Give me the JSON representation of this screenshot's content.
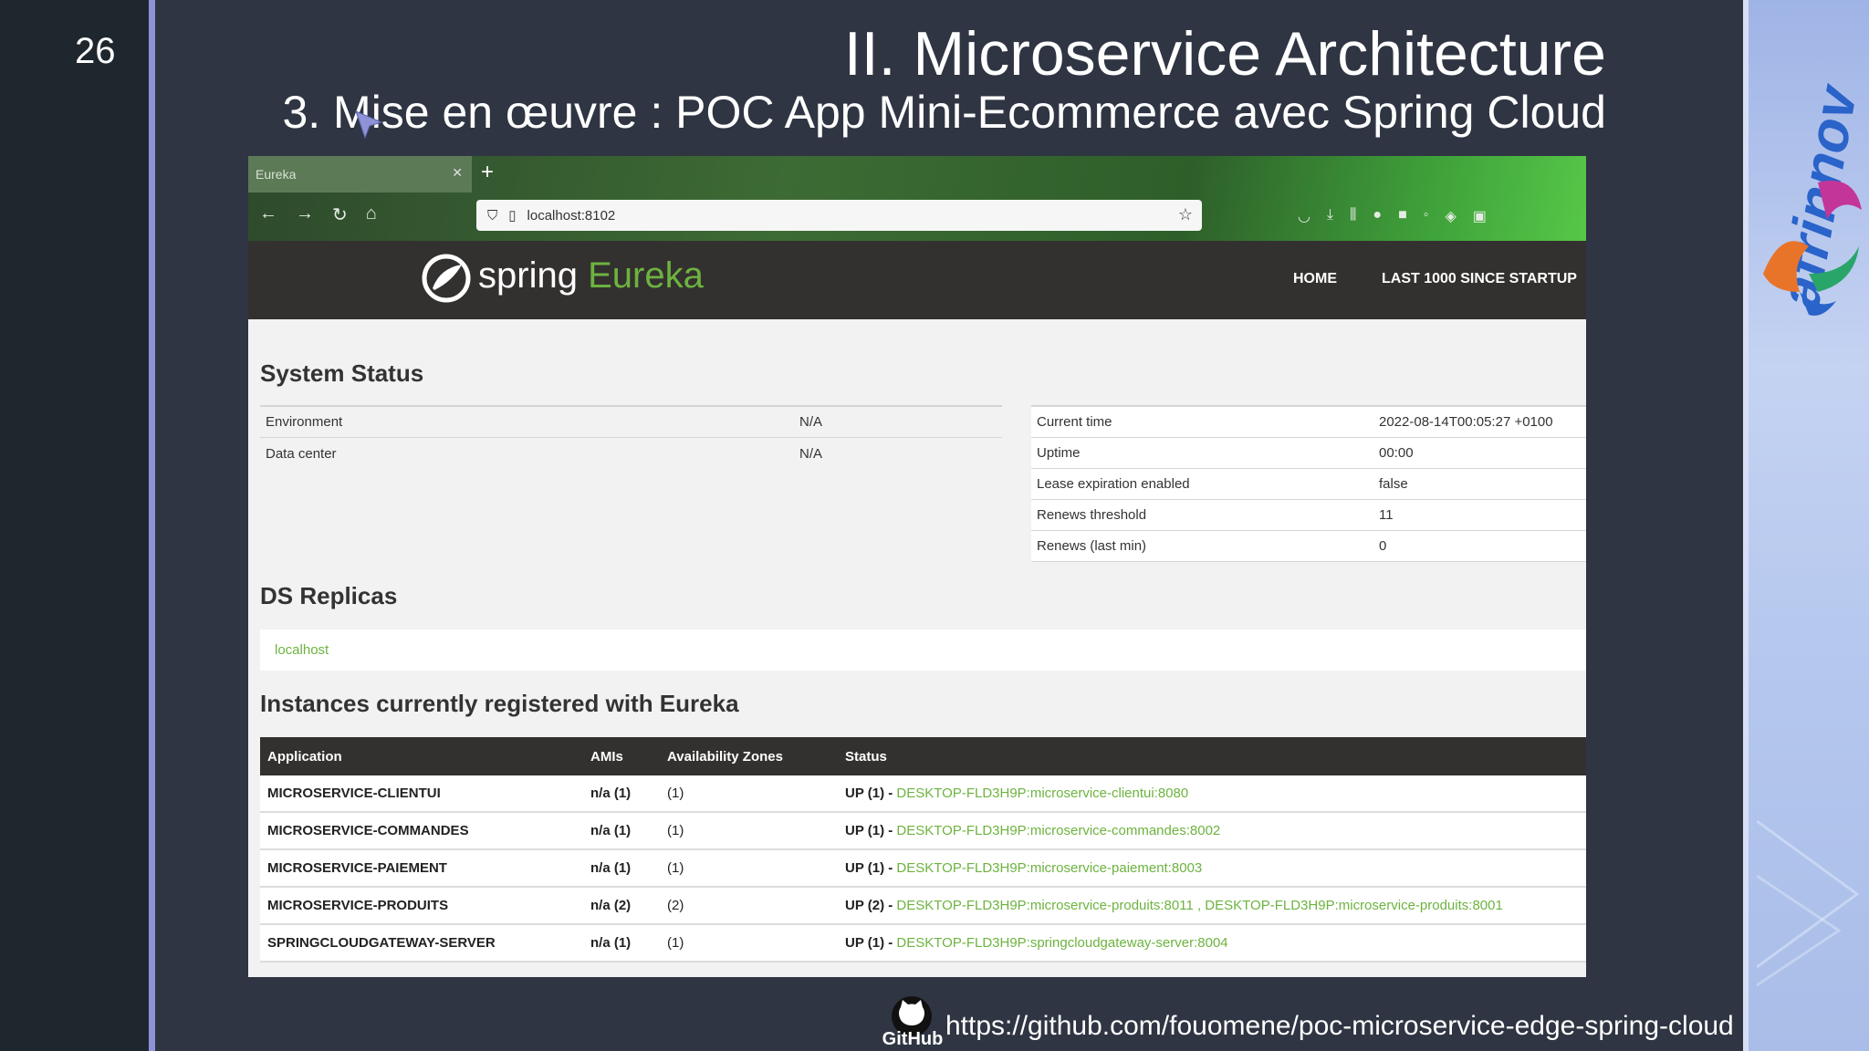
{
  "slide": {
    "number": "26",
    "title": "II. Microservice Architecture",
    "subtitle": "3. Mise en œuvre :  POC App Mini-Ecommerce avec Spring Cloud",
    "footer_link": "https://github.com/fouomene/poc-microservice-edge-spring-cloud",
    "github_label": "GitHub"
  },
  "browser": {
    "tab_title": "Eureka",
    "url": "localhost:8102"
  },
  "eureka": {
    "brand_spring": "spring",
    "brand_eureka": "Eureka",
    "nav": [
      "HOME",
      "LAST 1000 SINCE STARTUP"
    ],
    "system_status_title": "System Status",
    "status_left": [
      {
        "key": "Environment",
        "value": "N/A"
      },
      {
        "key": "Data center",
        "value": "N/A"
      }
    ],
    "status_right": [
      {
        "key": "Current time",
        "value": "2022-08-14T00:05:27 +0100"
      },
      {
        "key": "Uptime",
        "value": "00:00"
      },
      {
        "key": "Lease expiration enabled",
        "value": "false"
      },
      {
        "key": "Renews threshold",
        "value": "11"
      },
      {
        "key": "Renews (last min)",
        "value": "0"
      }
    ],
    "replicas_title": "DS Replicas",
    "replica": "localhost",
    "instances_title": "Instances currently registered with Eureka",
    "columns": [
      "Application",
      "AMIs",
      "Availability Zones",
      "Status"
    ],
    "rows": [
      {
        "app": "MICROSERVICE-CLIENTUI",
        "amis": "n/a (1)",
        "zones": "(1)",
        "status": "UP (1) - ",
        "links": "DESKTOP-FLD3H9P:microservice-clientui:8080"
      },
      {
        "app": "MICROSERVICE-COMMANDES",
        "amis": "n/a (1)",
        "zones": "(1)",
        "status": "UP (1) - ",
        "links": "DESKTOP-FLD3H9P:microservice-commandes:8002"
      },
      {
        "app": "MICROSERVICE-PAIEMENT",
        "amis": "n/a (1)",
        "zones": "(1)",
        "status": "UP (1) - ",
        "links": "DESKTOP-FLD3H9P:microservice-paiement:8003"
      },
      {
        "app": "MICROSERVICE-PRODUITS",
        "amis": "n/a (2)",
        "zones": "(2)",
        "status": "UP (2) - ",
        "links": "DESKTOP-FLD3H9P:microservice-produits:8011 , DESKTOP-FLD3H9P:microservice-produits:8001"
      },
      {
        "app": "SPRINGCLOUDGATEWAY-SERVER",
        "amis": "n/a (1)",
        "zones": "(1)",
        "status": "UP (1) - ",
        "links": "DESKTOP-FLD3H9P:springcloudgateway-server:8004"
      }
    ]
  },
  "colors": {
    "spring_green": "#6db33f",
    "eureka_dark": "#33312f",
    "slide_bg": "#2f3542",
    "accent_rule": "#8d93d6"
  }
}
